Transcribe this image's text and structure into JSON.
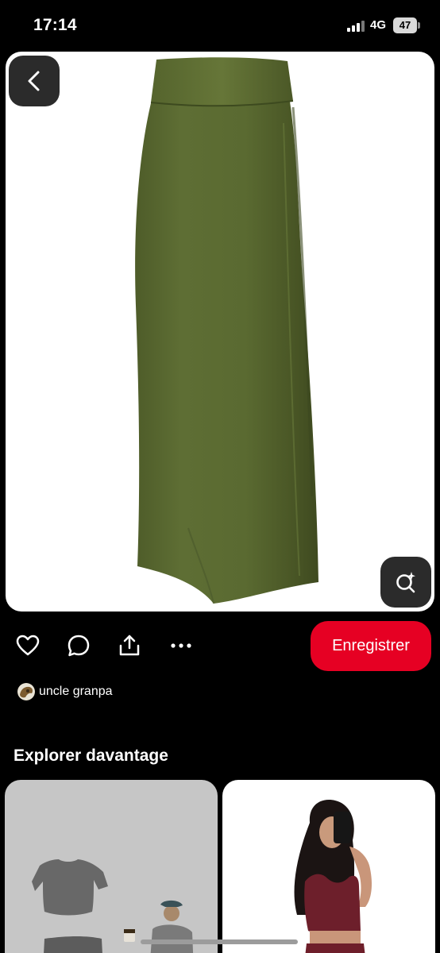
{
  "status_bar": {
    "time": "17:14",
    "network": "4G",
    "battery": "47"
  },
  "hero": {
    "image_description": "green-maxi-skirt"
  },
  "actions": {
    "save_label": "Enregistrer"
  },
  "author": {
    "name": "uncle granpa"
  },
  "explore": {
    "title": "Explorer davantage"
  },
  "colors": {
    "save_red": "#e60023",
    "skirt_green": "#5b6b32",
    "background": "#000000"
  }
}
